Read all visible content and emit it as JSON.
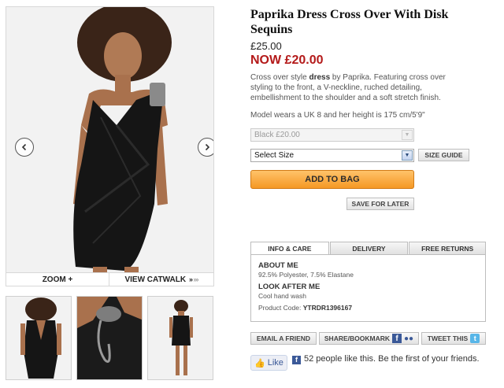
{
  "product": {
    "title": "Paprika Dress Cross Over With Disk Sequins",
    "price_was": "£25.00",
    "price_now": "NOW £20.00",
    "description_before": "Cross over style ",
    "description_bold": "dress",
    "description_after": " by Paprika. Featuring cross over styling to the front, a V-neckline, ruched detailing, embellishment to the shoulder and a soft stretch finish.",
    "model_note": "Model wears a UK 8 and her height is 175 cm/5'9\""
  },
  "gallery": {
    "zoom_label": "ZOOM +",
    "catwalk_label": "VIEW CATWALK",
    "prev_icon": "chevron-left-icon",
    "next_icon": "chevron-right-icon",
    "thumbnails": [
      "back-view",
      "shoulder-detail",
      "full-length"
    ]
  },
  "options": {
    "colour_value": "Black £20.00",
    "size_value": "Select Size",
    "size_guide_label": "SIZE GUIDE",
    "add_to_bag_label": "ADD TO BAG",
    "save_for_later_label": "SAVE FOR LATER"
  },
  "tabs": {
    "items": [
      "INFO & CARE",
      "DELIVERY",
      "FREE RETURNS"
    ],
    "active": "INFO & CARE"
  },
  "info_panel": {
    "about_heading": "ABOUT ME",
    "about_text": "92.5% Polyester, 7.5% Elastane",
    "care_heading": "LOOK AFTER ME",
    "care_text": "Cool hand wash",
    "code_label": "Product Code: ",
    "code_value": "YTRDR1396167"
  },
  "share": {
    "email_label": "EMAIL A FRIEND",
    "bookmark_label": "SHARE/BOOKMARK",
    "tweet_label": "TWEET THIS",
    "like_label": "Like",
    "like_text": "52 people like this. Be the first of your friends."
  },
  "colors": {
    "sale_red": "#b41a1a",
    "bag_orange": "#f59824",
    "facebook_blue": "#3b5998",
    "twitter_blue": "#58b6e8"
  }
}
